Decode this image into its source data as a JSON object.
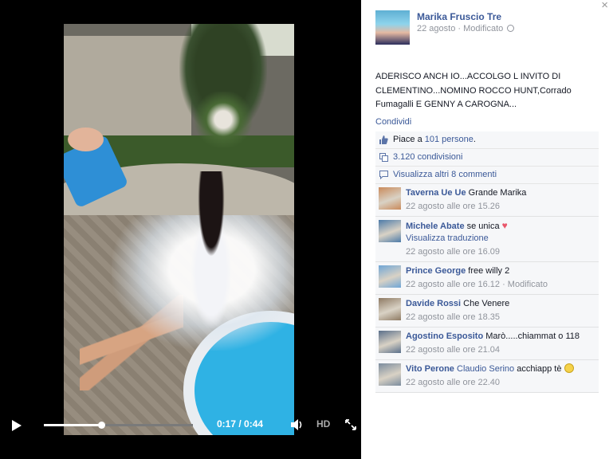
{
  "player": {
    "time": "0:17 / 0:44",
    "progress": 0.386,
    "hd_label": "HD"
  },
  "post": {
    "close_symbol": "×",
    "owner_name": "Marika Fruscio Tre",
    "date": "22 agosto",
    "edited": "· Modificato",
    "text": "ADERISCO ANCH IO...ACCOLGO L INVITO DI CLEMENTINO...NOMINO ROCCO HUNT,Corrado Fumagalli E GENNY A CAROGNA...",
    "share_link": "Condividi",
    "likes_prefix": "Piace a ",
    "likes_link": "101 persone",
    "likes_suffix": ".",
    "shares": "3.120 condivisioni",
    "view_more": "Visualizza altri 8 commenti"
  },
  "comments": [
    {
      "name": "Taverna Ue Ue",
      "text": "Grande Marika",
      "time": "22 agosto alle ore 15.26",
      "avatar_color": "#c98a5a"
    },
    {
      "name": "Michele Abate",
      "text": "se unica",
      "heart": "♥",
      "translate": "Visualizza traduzione",
      "time": "22 agosto alle ore 16.09",
      "avatar_color": "#4c7aa8"
    },
    {
      "name": "Prince George",
      "text": "free willy 2",
      "time": "22 agosto alle ore 16.12 · Modificato",
      "avatar_color": "#6fa6d6"
    },
    {
      "name": "Davide Rossi",
      "text": "Che Venere",
      "time": "22 agosto alle ore 18.35",
      "avatar_color": "#8e7a63"
    },
    {
      "name": "Agostino Esposito",
      "text": "Marò.....chiammat o 118",
      "time": "22 agosto alle ore 21.04",
      "avatar_color": "#5a6f8a"
    },
    {
      "name": "Vito Perone",
      "mention": "Claudio Serino",
      "text": "acchiapp tè",
      "time": "22 agosto alle ore 22.40",
      "avatar_color": "#7b8c9e"
    }
  ]
}
